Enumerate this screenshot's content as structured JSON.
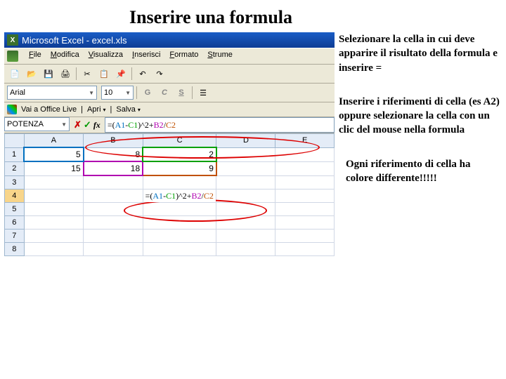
{
  "title": "Inserire una formula",
  "window_title": "Microsoft Excel - excel.xls",
  "menu": [
    "File",
    "Modifica",
    "Visualizza",
    "Inserisci",
    "Formato",
    "Strume"
  ],
  "font": {
    "name": "Arial",
    "size": "10"
  },
  "fmtbtns": {
    "b": "G",
    "i": "C",
    "u": "S"
  },
  "office": {
    "goto": "Vai a Office Live",
    "open": "Apri",
    "save": "Salva"
  },
  "namebox": "POTENZA",
  "formula_prefix": "=(",
  "ref_a1": "A1",
  "minus": "-",
  "ref_c1": "C1",
  "mid": ")^2+",
  "ref_b2": "B2",
  "slash": "/",
  "ref_c2": "C2",
  "cols": [
    "A",
    "B",
    "C",
    "D",
    "E"
  ],
  "rows": [
    "1",
    "2",
    "3",
    "4",
    "5",
    "6",
    "7",
    "8"
  ],
  "cells": {
    "A1": "5",
    "B1": "8",
    "C1": "2",
    "A2": "15",
    "B2": "18",
    "C2": "9"
  },
  "cell_formula": "=(A1-C1)^2+B2/C2",
  "side1": "Selezionare la cella in cui deve apparire il risultato della formula e inserire =",
  "side2": "Inserire i riferimenti di cella (es A2) oppure selezionare la cella con un clic del mouse nella formula",
  "side3": "Ogni riferimento di cella ha colore differente!!!!!"
}
